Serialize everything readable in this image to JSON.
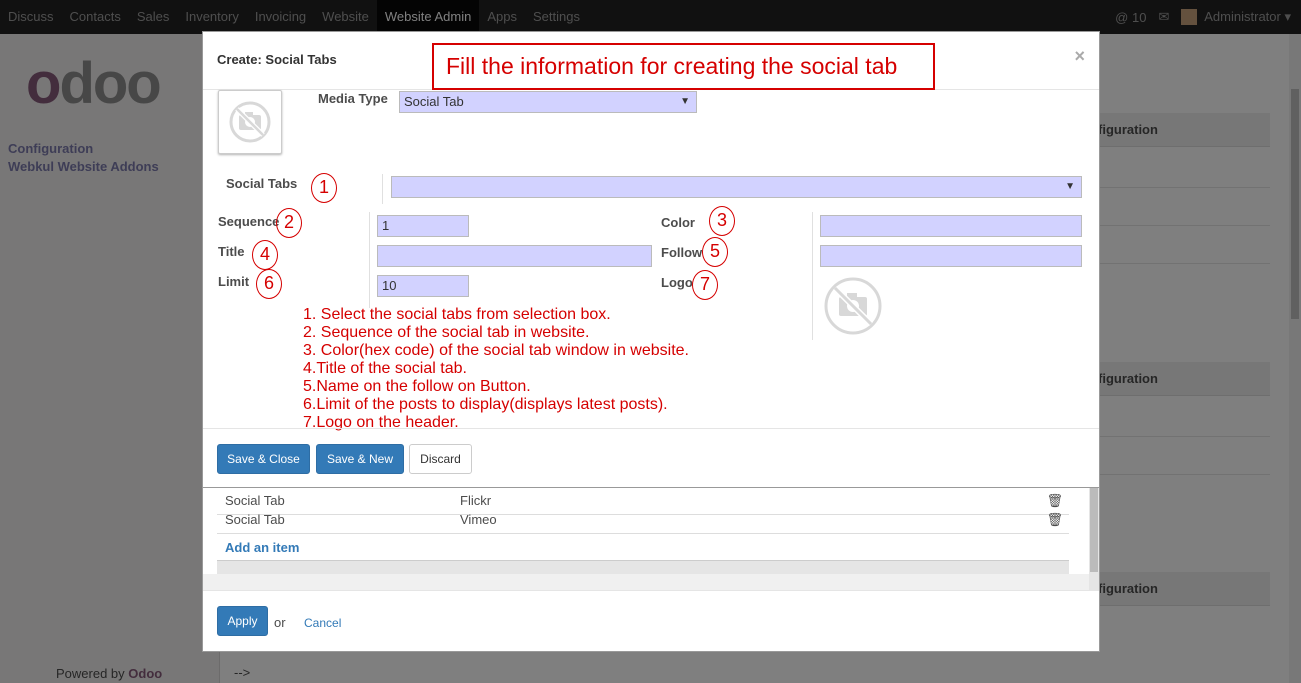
{
  "topbar": {
    "menu": [
      "Discuss",
      "Contacts",
      "Sales",
      "Inventory",
      "Invoicing",
      "Website",
      "Website Admin",
      "Apps",
      "Settings"
    ],
    "active": "Website Admin",
    "chat_count": "10",
    "user": "Administrator"
  },
  "sidebar": {
    "logo_first": "o",
    "logo_rest": "doo",
    "link1": "Configuration",
    "link2": "Webkul Website Addons",
    "powered_prefix": "Powered by",
    "powered_brand": "Odoo"
  },
  "background": {
    "config_label": "figuration",
    "arrow_text": "-->"
  },
  "dialog": {
    "title": "Create: Social Tabs",
    "close": "×",
    "callout": "Fill the information for creating the social tab",
    "media_type_label": "Media Type",
    "media_type_value": "Social Tab",
    "social_tabs_label": "Social Tabs",
    "social_tabs_value": "",
    "sequence_label": "Sequence",
    "sequence_value": "1",
    "title_label": "Title",
    "title_value": "",
    "limit_label": "Limit",
    "limit_value": "10",
    "color_label": "Color",
    "color_value": "",
    "follow_label": "Follow",
    "follow_value": "",
    "logo_label": "Logo",
    "numbers": [
      "1",
      "2",
      "3",
      "4",
      "5",
      "6",
      "7"
    ],
    "notes": [
      "1. Select the social tabs from selection box.",
      "2. Sequence of the social tab in website.",
      "3. Color(hex code) of the social tab window in website.",
      "4.Title of the social tab.",
      "5.Name on the follow on Button.",
      "6.Limit of the posts to display(displays latest posts).",
      "7.Logo on the header."
    ],
    "save_close": "Save & Close",
    "save_new": "Save & New",
    "discard": "Discard"
  },
  "lower": {
    "rows": [
      {
        "type": "Social Tab",
        "name": "Flickr"
      },
      {
        "type": "Social Tab",
        "name": "Vimeo"
      }
    ],
    "add_item": "Add an item",
    "apply": "Apply",
    "or": "or",
    "cancel": "Cancel"
  }
}
